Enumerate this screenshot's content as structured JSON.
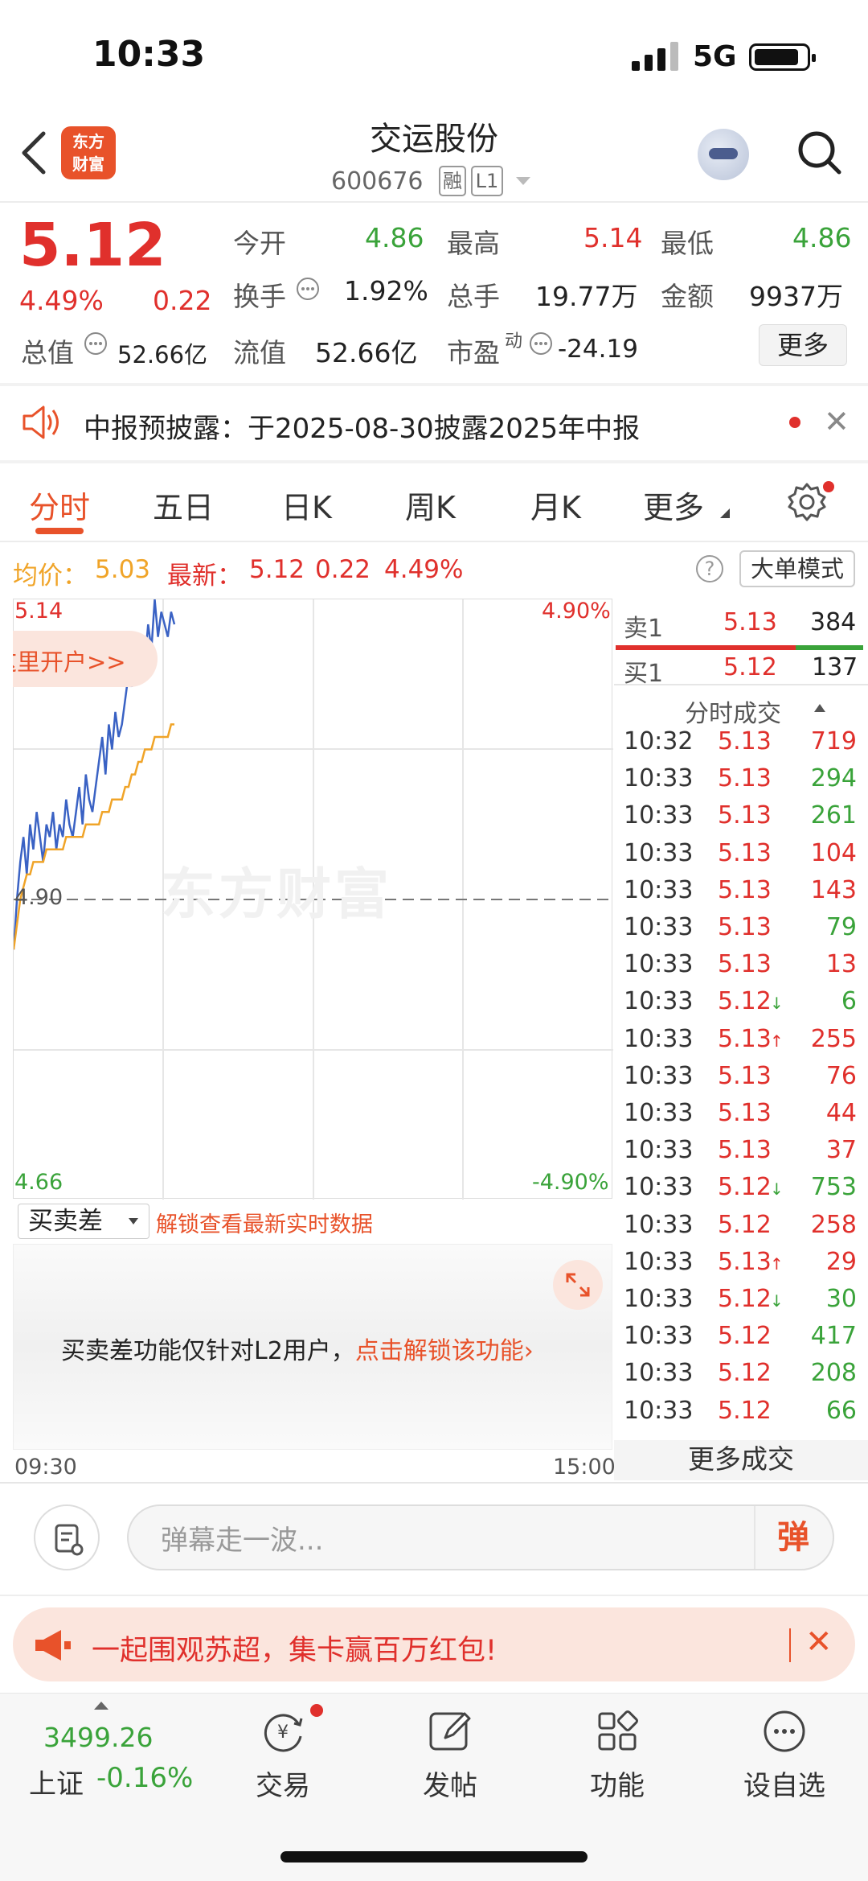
{
  "status": {
    "time": "10:33",
    "network": "5G"
  },
  "header": {
    "logo_line1": "东方",
    "logo_line2": "财富",
    "title": "交运股份",
    "code": "600676",
    "tag1": "融",
    "tag2": "L1"
  },
  "quote": {
    "price": "5.12",
    "change_pct": "4.49%",
    "change": "0.22",
    "open_label": "今开",
    "open": "4.86",
    "high_label": "最高",
    "high": "5.14",
    "low_label": "最低",
    "low": "4.86",
    "turnover_label": "换手",
    "turnover": "1.92%",
    "volume_label": "总手",
    "volume": "19.77万",
    "amount_label": "金额",
    "amount": "9937万",
    "mktcap_label": "总值",
    "mktcap": "52.66亿",
    "float_label": "流值",
    "float": "52.66亿",
    "pe_label": "市盈",
    "pe_sup": "动",
    "pe": "-24.19",
    "more": "更多"
  },
  "notice": {
    "text": "中报预披露：于2025-08-30披露2025年中报"
  },
  "tabs": [
    "分时",
    "五日",
    "日K",
    "周K",
    "月K",
    "更多"
  ],
  "info": {
    "avg_label": "均价：",
    "avg": "5.03",
    "latest_label": "最新：",
    "latest": "5.12",
    "change": "0.22",
    "pct": "4.49%",
    "help": "?",
    "mode": "大单模式"
  },
  "chart_data": {
    "type": "line",
    "y_max_label": "5.14",
    "y_min_label": "4.66",
    "y_mid_label": "4.90",
    "pct_max_label": "4.90%",
    "pct_min_label": "-4.90%",
    "x_start_label": "09:30",
    "x_end_label": "15:00",
    "ylim": [
      4.66,
      5.14
    ],
    "watermark": "东方财富",
    "promo": "这里开户>>",
    "series": [
      {
        "color": "#3a62c4",
        "values": [
          4.86,
          4.9,
          4.93,
          4.95,
          4.92,
          4.96,
          4.94,
          4.97,
          4.95,
          4.93,
          4.96,
          4.95,
          4.97,
          4.94,
          4.96,
          4.95,
          4.98,
          4.96,
          4.95,
          4.97,
          4.99,
          4.96,
          5.0,
          4.98,
          4.97,
          4.99,
          5.01,
          5.03,
          5.0,
          5.04,
          5.02,
          5.05,
          5.03,
          5.04,
          5.06,
          5.08,
          5.07,
          5.1,
          5.09,
          5.11,
          5.09,
          5.12,
          5.1,
          5.14,
          5.11,
          5.13,
          5.12,
          5.11,
          5.13,
          5.12
        ]
      },
      {
        "color": "#f0a428",
        "values": [
          4.86,
          4.88,
          4.9,
          4.91,
          4.92,
          4.92,
          4.93,
          4.93,
          4.93,
          4.93,
          4.94,
          4.94,
          4.94,
          4.94,
          4.94,
          4.94,
          4.95,
          4.95,
          4.95,
          4.95,
          4.95,
          4.95,
          4.96,
          4.96,
          4.96,
          4.96,
          4.96,
          4.97,
          4.97,
          4.97,
          4.98,
          4.98,
          4.98,
          4.98,
          4.99,
          4.99,
          5.0,
          5.0,
          5.01,
          5.01,
          5.02,
          5.02,
          5.02,
          5.03,
          5.03,
          5.03,
          5.03,
          5.03,
          5.04,
          5.04
        ]
      }
    ]
  },
  "orderbook": {
    "sell_label": "卖1",
    "sell_price": "5.13",
    "sell_vol": "384",
    "buy_label": "买1",
    "buy_price": "5.12",
    "buy_vol": "137"
  },
  "ticks_title": "分时成交",
  "ticks": [
    {
      "time": "10:32",
      "price": "5.13",
      "arrow": "",
      "vol": "719",
      "side": "red"
    },
    {
      "time": "10:33",
      "price": "5.13",
      "arrow": "",
      "vol": "294",
      "side": "green"
    },
    {
      "time": "10:33",
      "price": "5.13",
      "arrow": "",
      "vol": "261",
      "side": "green"
    },
    {
      "time": "10:33",
      "price": "5.13",
      "arrow": "",
      "vol": "104",
      "side": "red"
    },
    {
      "time": "10:33",
      "price": "5.13",
      "arrow": "",
      "vol": "143",
      "side": "red"
    },
    {
      "time": "10:33",
      "price": "5.13",
      "arrow": "",
      "vol": "79",
      "side": "green"
    },
    {
      "time": "10:33",
      "price": "5.13",
      "arrow": "",
      "vol": "13",
      "side": "red"
    },
    {
      "time": "10:33",
      "price": "5.12",
      "arrow": "↓",
      "vol": "6",
      "side": "green"
    },
    {
      "time": "10:33",
      "price": "5.13",
      "arrow": "↑",
      "vol": "255",
      "side": "red"
    },
    {
      "time": "10:33",
      "price": "5.13",
      "arrow": "",
      "vol": "76",
      "side": "red"
    },
    {
      "time": "10:33",
      "price": "5.13",
      "arrow": "",
      "vol": "44",
      "side": "red"
    },
    {
      "time": "10:33",
      "price": "5.13",
      "arrow": "",
      "vol": "37",
      "side": "red"
    },
    {
      "time": "10:33",
      "price": "5.12",
      "arrow": "↓",
      "vol": "753",
      "side": "green"
    },
    {
      "time": "10:33",
      "price": "5.12",
      "arrow": "",
      "vol": "258",
      "side": "red"
    },
    {
      "time": "10:33",
      "price": "5.13",
      "arrow": "↑",
      "vol": "29",
      "side": "red"
    },
    {
      "time": "10:33",
      "price": "5.12",
      "arrow": "↓",
      "vol": "30",
      "side": "green"
    },
    {
      "time": "10:33",
      "price": "5.12",
      "arrow": "",
      "vol": "417",
      "side": "green"
    },
    {
      "time": "10:33",
      "price": "5.12",
      "arrow": "",
      "vol": "208",
      "side": "green"
    },
    {
      "time": "10:33",
      "price": "5.12",
      "arrow": "",
      "vol": "66",
      "side": "green"
    }
  ],
  "more_trades": "更多成交",
  "subpanel": {
    "select": "买卖差",
    "unlock_link": "解锁查看最新实时数据",
    "msg": "买卖差功能仅针对L2用户，",
    "msg_link": "点击解锁该功能›"
  },
  "danmaku": {
    "placeholder": "弹幕走一波...",
    "send": "弹"
  },
  "banner": {
    "text": "一起围观苏超，集卡赢百万红包!"
  },
  "bottom_nav": {
    "index_value": "3499.26",
    "index_name": "上证",
    "index_change": "-0.16%",
    "items": [
      "交易",
      "发帖",
      "功能",
      "设自选"
    ]
  },
  "colors": {
    "up": "#e0302c",
    "down": "#3aa33a",
    "brand": "#e8522a"
  }
}
